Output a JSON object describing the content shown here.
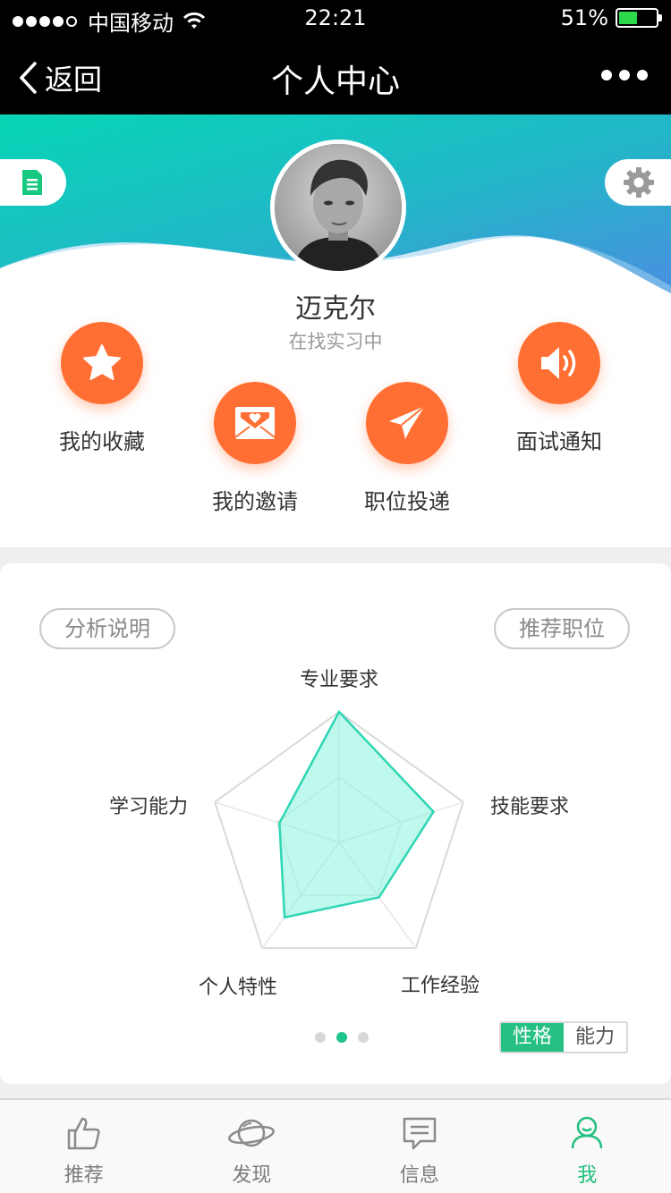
{
  "status_bar": {
    "carrier": "中国移动",
    "time": "22:21",
    "battery": "51%",
    "battery_level": 0.51
  },
  "nav": {
    "back_label": "返回",
    "title": "个人中心",
    "more_icon": "more-dots-icon"
  },
  "profile": {
    "name": "迈克尔",
    "status": "在找实习中",
    "theme_colors": {
      "wave_start": "#09d3b3",
      "wave_end": "#3a8fdc",
      "accent_green": "#1fbf7c",
      "accent_orange": "#ff6f33"
    },
    "quick_actions": [
      {
        "label": "我的收藏",
        "icon": "star-icon"
      },
      {
        "label": "我的邀请",
        "icon": "envelope-heart-icon"
      },
      {
        "label": "职位投递",
        "icon": "paper-plane-icon"
      },
      {
        "label": "面试通知",
        "icon": "speaker-icon"
      }
    ]
  },
  "analysis": {
    "left_button": "分析说明",
    "right_button": "推荐职位",
    "radar_labels": [
      "专业要求",
      "技能要求",
      "工作经验",
      "个人特性",
      "学习能力"
    ],
    "radar_values": [
      1.0,
      0.76,
      0.52,
      0.71,
      0.48
    ],
    "pager_active": 1,
    "segments": [
      "性格",
      "能力"
    ],
    "segment_active": 0
  },
  "tabbar": {
    "tabs": [
      {
        "label": "推荐",
        "icon": "thumbs-up-icon"
      },
      {
        "label": "发现",
        "icon": "planet-icon"
      },
      {
        "label": "信息",
        "icon": "chat-icon"
      },
      {
        "label": "我",
        "icon": "person-icon"
      }
    ],
    "active": 3
  }
}
